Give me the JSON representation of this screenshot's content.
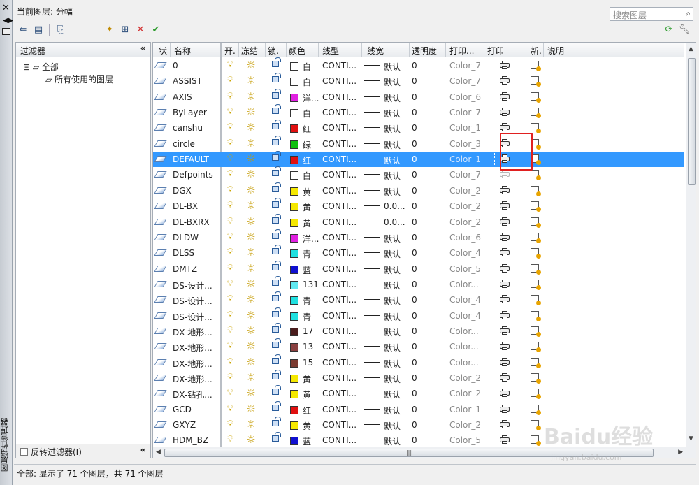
{
  "window": {
    "current_layer_label": "当前图层: 分幅",
    "search_placeholder": "搜索图层",
    "side_title": "图层特性管理器"
  },
  "filter_pane": {
    "header": "过滤器",
    "tree_root": "全部",
    "tree_child": "所有使用的图层",
    "invert_label": "反转过滤器(I)"
  },
  "columns": [
    "状",
    "名称",
    "开.",
    "冻结",
    "锁.",
    "颜色",
    "线型",
    "线宽",
    "透明度",
    "打印...",
    "打印",
    "新.",
    "说明"
  ],
  "layers": [
    {
      "name": "0",
      "color_name": "白",
      "color_hex": "#ffffff",
      "linetype": "CONTI...",
      "lineweight": "默认",
      "transparency": "0",
      "plot_style": "Color_7"
    },
    {
      "name": "ASSIST",
      "color_name": "白",
      "color_hex": "#ffffff",
      "linetype": "CONTI...",
      "lineweight": "默认",
      "transparency": "0",
      "plot_style": "Color_7"
    },
    {
      "name": "AXIS",
      "color_name": "洋...",
      "color_hex": "#e020e0",
      "linetype": "CONTI...",
      "lineweight": "默认",
      "transparency": "0",
      "plot_style": "Color_6"
    },
    {
      "name": "ByLayer",
      "color_name": "白",
      "color_hex": "#ffffff",
      "linetype": "CONTI...",
      "lineweight": "默认",
      "transparency": "0",
      "plot_style": "Color_7"
    },
    {
      "name": "canshu",
      "color_name": "红",
      "color_hex": "#e01010",
      "linetype": "CONTI...",
      "lineweight": "默认",
      "transparency": "0",
      "plot_style": "Color_1"
    },
    {
      "name": "circle",
      "color_name": "绿",
      "color_hex": "#10c010",
      "linetype": "CONTI...",
      "lineweight": "默认",
      "transparency": "0",
      "plot_style": "Color_3"
    },
    {
      "name": "DEFAULT",
      "color_name": "红",
      "color_hex": "#e01010",
      "linetype": "CONTI...",
      "lineweight": "默认",
      "transparency": "0",
      "plot_style": "Color_1",
      "selected": true
    },
    {
      "name": "Defpoints",
      "color_name": "白",
      "color_hex": "#ffffff",
      "linetype": "CONTI...",
      "lineweight": "默认",
      "transparency": "0",
      "plot_style": "Color_7",
      "no_plot": true
    },
    {
      "name": "DGX",
      "color_name": "黄",
      "color_hex": "#f5e800",
      "linetype": "CONTI...",
      "lineweight": "默认",
      "transparency": "0",
      "plot_style": "Color_2"
    },
    {
      "name": "DL-BX",
      "color_name": "黄",
      "color_hex": "#f5e800",
      "linetype": "CONTI...",
      "lineweight": "0.0...",
      "transparency": "0",
      "plot_style": "Color_2"
    },
    {
      "name": "DL-BXRX",
      "color_name": "黄",
      "color_hex": "#f5e800",
      "linetype": "CONTI...",
      "lineweight": "0.0...",
      "transparency": "0",
      "plot_style": "Color_2"
    },
    {
      "name": "DLDW",
      "color_name": "洋...",
      "color_hex": "#e020e0",
      "linetype": "CONTI...",
      "lineweight": "默认",
      "transparency": "0",
      "plot_style": "Color_6"
    },
    {
      "name": "DLSS",
      "color_name": "青",
      "color_hex": "#20e0e0",
      "linetype": "CONTI...",
      "lineweight": "默认",
      "transparency": "0",
      "plot_style": "Color_4"
    },
    {
      "name": "DMTZ",
      "color_name": "蓝",
      "color_hex": "#1010d0",
      "linetype": "CONTI...",
      "lineweight": "默认",
      "transparency": "0",
      "plot_style": "Color_5"
    },
    {
      "name": "DS-设计...",
      "color_name": "131",
      "color_hex": "#60e8f0",
      "linetype": "CONTI...",
      "lineweight": "默认",
      "transparency": "0",
      "plot_style": "Color..."
    },
    {
      "name": "DS-设计...",
      "color_name": "青",
      "color_hex": "#20e0e0",
      "linetype": "CONTI...",
      "lineweight": "默认",
      "transparency": "0",
      "plot_style": "Color_4"
    },
    {
      "name": "DS-设计...",
      "color_name": "青",
      "color_hex": "#20e0e0",
      "linetype": "CONTI...",
      "lineweight": "默认",
      "transparency": "0",
      "plot_style": "Color_4"
    },
    {
      "name": "DX-地形...",
      "color_name": "17",
      "color_hex": "#4a1c1c",
      "linetype": "CONTI...",
      "lineweight": "默认",
      "transparency": "0",
      "plot_style": "Color..."
    },
    {
      "name": "DX-地形...",
      "color_name": "13",
      "color_hex": "#8a4040",
      "linetype": "CONTI...",
      "lineweight": "默认",
      "transparency": "0",
      "plot_style": "Color..."
    },
    {
      "name": "DX-地形...",
      "color_name": "15",
      "color_hex": "#7a3a30",
      "linetype": "CONTI...",
      "lineweight": "默认",
      "transparency": "0",
      "plot_style": "Color..."
    },
    {
      "name": "DX-地形...",
      "color_name": "黄",
      "color_hex": "#f5e800",
      "linetype": "CONTI...",
      "lineweight": "默认",
      "transparency": "0",
      "plot_style": "Color_2"
    },
    {
      "name": "DX-钻孔...",
      "color_name": "黄",
      "color_hex": "#f5e800",
      "linetype": "CONTI...",
      "lineweight": "默认",
      "transparency": "0",
      "plot_style": "Color_2"
    },
    {
      "name": "GCD",
      "color_name": "红",
      "color_hex": "#e01010",
      "linetype": "CONTI...",
      "lineweight": "默认",
      "transparency": "0",
      "plot_style": "Color_1"
    },
    {
      "name": "GXYZ",
      "color_name": "黄",
      "color_hex": "#f5e800",
      "linetype": "CONTI...",
      "lineweight": "默认",
      "transparency": "0",
      "plot_style": "Color_2"
    },
    {
      "name": "HDM_BZ",
      "color_name": "蓝",
      "color_hex": "#1010d0",
      "linetype": "CONTI...",
      "lineweight": "默认",
      "transparency": "0",
      "plot_style": "Color_5"
    }
  ],
  "status_bar": "全部: 显示了 71 个图层，共 71 个图层",
  "watermark": "Baidu经验",
  "watermark_sub": "jingyan.baidu.com",
  "colors": {
    "selection": "#3399ff",
    "highlight_box": "#e02020"
  }
}
